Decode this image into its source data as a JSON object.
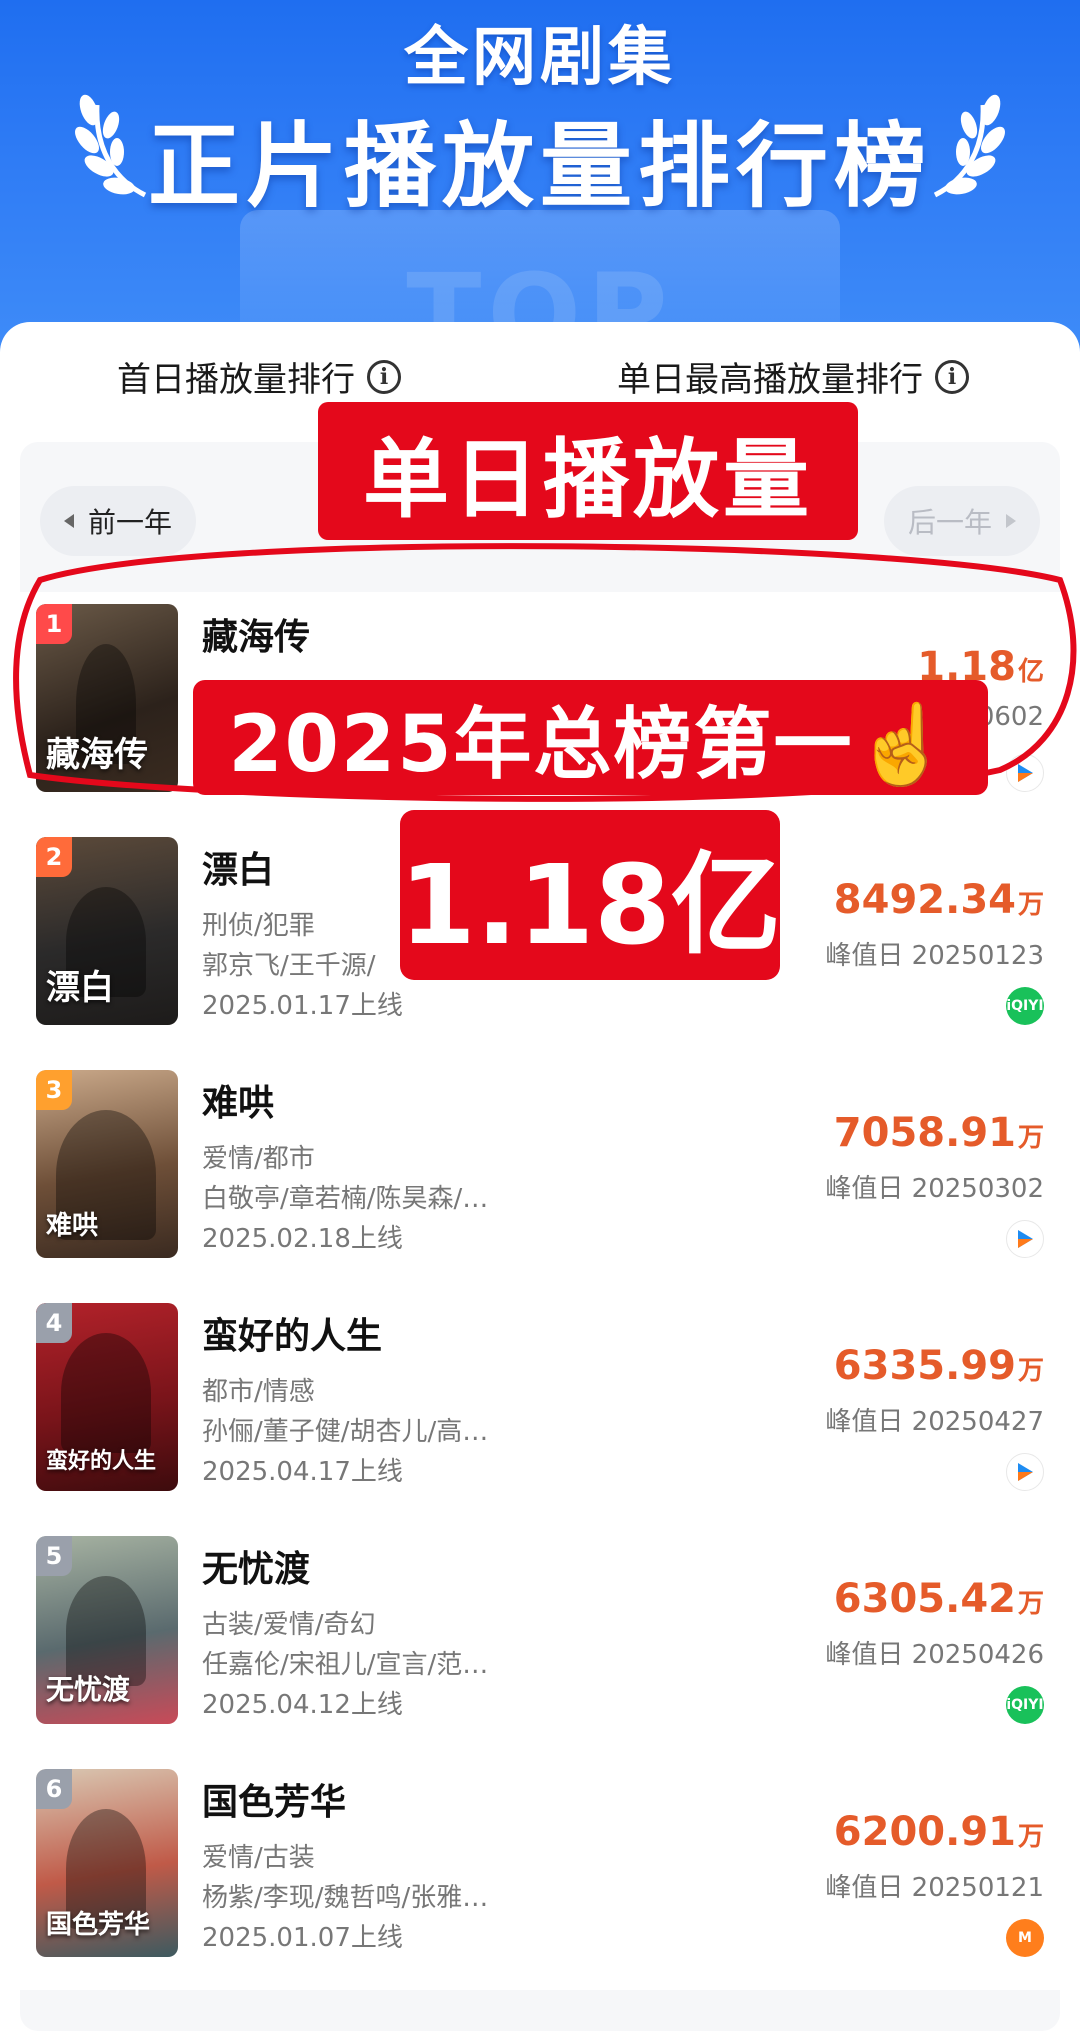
{
  "banner": {
    "subtitle": "全网剧集",
    "title": "正片播放量排行榜",
    "ghost_text": "TOP"
  },
  "tabs": [
    {
      "label": "首日播放量排行"
    },
    {
      "label": "单日最高播放量排行"
    }
  ],
  "year_nav": {
    "prev_label": "前一年",
    "next_label": "后一年"
  },
  "overlays": {
    "label1": "单日播放量",
    "label2": "2025年总榜第一☝️",
    "label3": "1.18亿"
  },
  "rows": [
    {
      "rank": "1",
      "name": "藏海传",
      "genre": "",
      "cast": "",
      "date": "",
      "plays": "1.18",
      "unit": "亿",
      "peak": "0602",
      "poster_text": "藏海传",
      "platform": "youku",
      "rank_color": "#ff4a4a"
    },
    {
      "rank": "2",
      "name": "漂白",
      "genre": "刑侦/犯罪",
      "cast": "郭京飞/王千源/",
      "date": "2025.01.17上线",
      "plays": "8492.34",
      "unit": "万",
      "peak": "峰值日 20250123",
      "poster_text": "漂白",
      "platform": "iqiyi",
      "rank_color": "#ff6b3a"
    },
    {
      "rank": "3",
      "name": "难哄",
      "genre": "爱情/都市",
      "cast": "白敬亭/章若楠/陈昊森/…",
      "date": "2025.02.18上线",
      "plays": "7058.91",
      "unit": "万",
      "peak": "峰值日 20250302",
      "poster_text": "难哄",
      "platform": "youku",
      "rank_color": "#ffa02e"
    },
    {
      "rank": "4",
      "name": "蛮好的人生",
      "genre": "都市/情感",
      "cast": "孙俪/董子健/胡杏儿/高…",
      "date": "2025.04.17上线",
      "plays": "6335.99",
      "unit": "万",
      "peak": "峰值日 20250427",
      "poster_text": "蛮好的人生",
      "platform": "youku",
      "rank_color": "#9aa0ab"
    },
    {
      "rank": "5",
      "name": "无忧渡",
      "genre": "古装/爱情/奇幻",
      "cast": "任嘉伦/宋祖儿/宣言/范…",
      "date": "2025.04.12上线",
      "plays": "6305.42",
      "unit": "万",
      "peak": "峰值日 20250426",
      "poster_text": "无忧渡",
      "platform": "iqiyi",
      "rank_color": "#9aa0ab"
    },
    {
      "rank": "6",
      "name": "国色芳华",
      "genre": "爱情/古装",
      "cast": "杨紫/李现/魏哲鸣/张雅…",
      "date": "2025.01.07上线",
      "plays": "6200.91",
      "unit": "万",
      "peak": "峰值日 20250121",
      "poster_text": "国色芳华",
      "platform": "mgtv",
      "rank_color": "#9aa0ab"
    }
  ],
  "colors": {
    "accent_red": "#e4081b",
    "play_orange": "#e55b2a",
    "banner_blue": "#1f6ef0"
  }
}
